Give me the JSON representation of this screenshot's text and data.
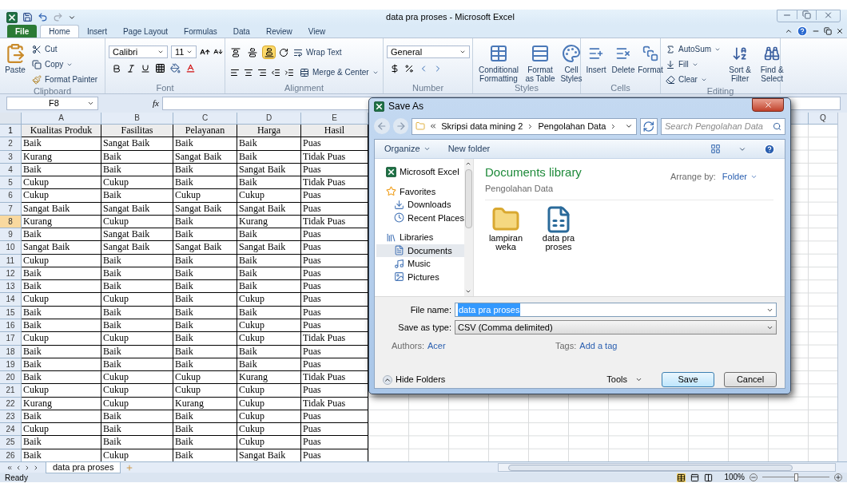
{
  "window": {
    "title": "data pra proses - Microsoft Excel"
  },
  "ribbon_tabs": [
    {
      "label": "File",
      "kind": "file",
      "selected": false
    },
    {
      "label": "Home",
      "kind": "tab",
      "selected": true
    },
    {
      "label": "Insert",
      "kind": "tab",
      "selected": false
    },
    {
      "label": "Page Layout",
      "kind": "tab",
      "selected": false
    },
    {
      "label": "Formulas",
      "kind": "tab",
      "selected": false
    },
    {
      "label": "Data",
      "kind": "tab",
      "selected": false
    },
    {
      "label": "Review",
      "kind": "tab",
      "selected": false
    },
    {
      "label": "View",
      "kind": "tab",
      "selected": false
    }
  ],
  "ribbon": {
    "clipboard": {
      "label": "Clipboard",
      "paste": "Paste",
      "cut": "Cut",
      "copy": "Copy",
      "format_painter": "Format Painter"
    },
    "font": {
      "label": "Font",
      "font_name": "Calibri",
      "font_size": "11"
    },
    "alignment": {
      "label": "Alignment",
      "wrap_text": "Wrap Text",
      "merge_center": "Merge & Center",
      "vertical_align": [
        {
          "selected": false
        },
        {
          "selected": false
        },
        {
          "selected": true
        }
      ]
    },
    "number": {
      "label": "Number",
      "format": "General"
    },
    "styles": {
      "label": "Styles",
      "buttons": [
        "Conditional Formatting",
        "Format as Table",
        "Cell Styles"
      ]
    },
    "cells": {
      "label": "Cells",
      "buttons": [
        "Insert",
        "Delete",
        "Format"
      ]
    },
    "editing": {
      "label": "Editing",
      "small_buttons": [
        "AutoSum",
        "Fill",
        "Clear"
      ],
      "large_buttons": [
        "Sort & Filter",
        "Find & Select"
      ]
    }
  },
  "formula_bar": {
    "name_box": "F8",
    "function_label": "fx"
  },
  "sheet": {
    "column_headers": [
      "A",
      "B",
      "C",
      "D",
      "E"
    ],
    "far_column_header": "Q",
    "header_row": {
      "number": "1",
      "cells": [
        "Kualitas Produk",
        "Fasilitas",
        "Pelayanan",
        "Harga",
        "Hasil"
      ]
    },
    "rows": [
      {
        "number": "2",
        "selected": false,
        "cells": [
          "Baik",
          "Sangat Baik",
          "Baik",
          "Baik",
          "Puas"
        ]
      },
      {
        "number": "3",
        "selected": false,
        "cells": [
          "Kurang",
          "Baik",
          "Sangat Baik",
          "Baik",
          "Tidak Puas"
        ]
      },
      {
        "number": "4",
        "selected": false,
        "cells": [
          "Baik",
          "Baik",
          "Baik",
          "Sangat Baik",
          "Puas"
        ]
      },
      {
        "number": "5",
        "selected": false,
        "cells": [
          "Cukup",
          "Cukup",
          "Baik",
          "Baik",
          "Tidak Puas"
        ]
      },
      {
        "number": "6",
        "selected": false,
        "cells": [
          "Cukup",
          "Baik",
          "Cukup",
          "Cukup",
          "Puas"
        ]
      },
      {
        "number": "7",
        "selected": false,
        "cells": [
          "Sangat Baik",
          "Sangat Baik",
          "Sangat Baik",
          "Sangat Baik",
          "Puas"
        ]
      },
      {
        "number": "8",
        "selected": true,
        "cells": [
          "Kurang",
          "Cukup",
          "Baik",
          "Kurang",
          "Tidak Puas"
        ]
      },
      {
        "number": "9",
        "selected": false,
        "cells": [
          "Baik",
          "Sangat Baik",
          "Baik",
          "Baik",
          "Puas"
        ]
      },
      {
        "number": "10",
        "selected": false,
        "cells": [
          "Sangat Baik",
          "Sangat Baik",
          "Sangat Baik",
          "Sangat Baik",
          "Puas"
        ]
      },
      {
        "number": "11",
        "selected": false,
        "cells": [
          "Cukup",
          "Baik",
          "Baik",
          "Baik",
          "Puas"
        ]
      },
      {
        "number": "12",
        "selected": false,
        "cells": [
          "Baik",
          "Baik",
          "Baik",
          "Baik",
          "Puas"
        ]
      },
      {
        "number": "13",
        "selected": false,
        "cells": [
          "Baik",
          "Baik",
          "Baik",
          "Baik",
          "Puas"
        ]
      },
      {
        "number": "14",
        "selected": false,
        "cells": [
          "Cukup",
          "Cukup",
          "Baik",
          "Cukup",
          "Puas"
        ]
      },
      {
        "number": "15",
        "selected": false,
        "cells": [
          "Baik",
          "Baik",
          "Baik",
          "Baik",
          "Puas"
        ]
      },
      {
        "number": "16",
        "selected": false,
        "cells": [
          "Baik",
          "Baik",
          "Baik",
          "Cukup",
          "Puas"
        ]
      },
      {
        "number": "17",
        "selected": false,
        "cells": [
          "Cukup",
          "Cukup",
          "Baik",
          "Cukup",
          "Tidak Puas"
        ]
      },
      {
        "number": "18",
        "selected": false,
        "cells": [
          "Baik",
          "Baik",
          "Baik",
          "Baik",
          "Puas"
        ]
      },
      {
        "number": "19",
        "selected": false,
        "cells": [
          "Baik",
          "Baik",
          "Baik",
          "Baik",
          "Puas"
        ]
      },
      {
        "number": "20",
        "selected": false,
        "cells": [
          "Baik",
          "Cukup",
          "Cukup",
          "Kurang",
          "Tidak Puas"
        ]
      },
      {
        "number": "21",
        "selected": false,
        "cells": [
          "Cukup",
          "Cukup",
          "Cukup",
          "Cukup",
          "Puas"
        ]
      },
      {
        "number": "22",
        "selected": false,
        "cells": [
          "Kurang",
          "Cukup",
          "Kurang",
          "Cukup",
          "Tidak Puas"
        ]
      },
      {
        "number": "23",
        "selected": false,
        "cells": [
          "Baik",
          "Baik",
          "Baik",
          "Cukup",
          "Puas"
        ]
      },
      {
        "number": "24",
        "selected": false,
        "cells": [
          "Cukup",
          "Baik",
          "Baik",
          "Cukup",
          "Puas"
        ]
      },
      {
        "number": "25",
        "selected": false,
        "cells": [
          "Baik",
          "Baik",
          "Baik",
          "Cukup",
          "Puas"
        ]
      },
      {
        "number": "26",
        "selected": false,
        "cells": [
          "Baik",
          "Cukup",
          "Baik",
          "Sangat Baik",
          "Puas"
        ]
      }
    ]
  },
  "sheet_tabs": [
    {
      "label": "data pra proses",
      "selected": true
    }
  ],
  "status_bar": {
    "text": "Ready",
    "zoom": "100%",
    "zoom_level": {
      "level": 0.5
    }
  },
  "dialog": {
    "title": "Save As",
    "breadcrumb": [
      "Skripsi data mining 2",
      "Pengolahan Data"
    ],
    "search": {
      "placeholder": "Search Pengolahan Data"
    },
    "toolbar": [
      "Organize",
      "New folder"
    ],
    "nav": [
      {
        "label": "Microsoft Excel",
        "kind": "app",
        "selected": false
      },
      {
        "label": "Favorites",
        "kind": "group",
        "selected": false
      },
      {
        "label": "Downloads",
        "kind": "item",
        "selected": false
      },
      {
        "label": "Recent Places",
        "kind": "item",
        "selected": false
      },
      {
        "label": "Libraries",
        "kind": "group",
        "selected": false
      },
      {
        "label": "Documents",
        "kind": "item",
        "selected": true
      },
      {
        "label": "Music",
        "kind": "item",
        "selected": false
      },
      {
        "label": "Pictures",
        "kind": "item",
        "selected": false
      }
    ],
    "library": {
      "title": "Documents library",
      "subtitle": "Pengolahan Data",
      "arrange_label": "Arrange by:",
      "arrange_value": "Folder"
    },
    "files": [
      {
        "name": "lampiran weka",
        "kind": "folder"
      },
      {
        "name": "data pra proses",
        "kind": "csv"
      }
    ],
    "file_name": {
      "label": "File name:",
      "value": "data pra proses"
    },
    "save_as_type": {
      "label": "Save as type:",
      "value": "CSV (Comma delimited)"
    },
    "authors": {
      "label": "Authors:",
      "value": "Acer"
    },
    "tags": {
      "label": "Tags:",
      "value": "Add a tag"
    },
    "hide_folders": "Hide Folders",
    "tools": "Tools",
    "buttons": [
      "Save",
      "Cancel"
    ]
  }
}
